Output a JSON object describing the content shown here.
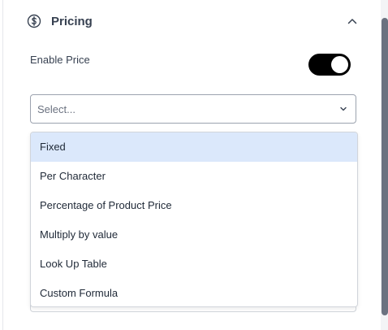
{
  "section": {
    "title": "Pricing",
    "icon": "dollar-circle-icon"
  },
  "enable_price": {
    "label": "Enable Price",
    "enabled": true
  },
  "select": {
    "placeholder": "Select...",
    "options": [
      "Fixed",
      "Per Character",
      "Percentage of Product Price",
      "Multiply by value",
      "Look Up Table",
      "Custom Formula"
    ],
    "highlighted_index": 0
  },
  "colors": {
    "toggle_on": "#000000",
    "highlight": "#dbe8fb"
  }
}
